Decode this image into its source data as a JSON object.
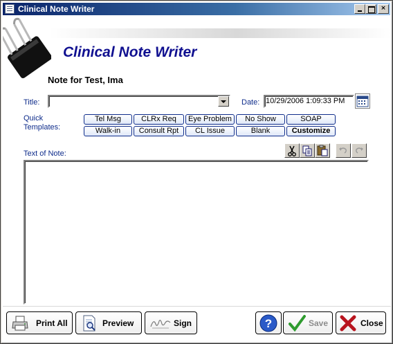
{
  "window": {
    "title": "Clinical Note Writer",
    "controls": {
      "minimize": "minimize",
      "maximize": "maximize",
      "close": "×"
    }
  },
  "header": {
    "heading": "Clinical Note Writer",
    "note_for": "Note for Test, Ima"
  },
  "form": {
    "title_label": "Title:",
    "title_value": "",
    "date_label": "Date:",
    "date_value": "10/29/2006 1:09:33 PM",
    "quick_templates_label_line1": "Quick",
    "quick_templates_label_line2": "Templates:",
    "text_of_note_label": "Text of Note:",
    "note_text": ""
  },
  "quick_templates": {
    "row1": [
      "Tel Msg",
      "CLRx Req",
      "Eye Problem",
      "No Show",
      "SOAP"
    ],
    "row2": [
      "Walk-in",
      "Consult Rpt",
      "CL Issue",
      "Blank",
      "Customize"
    ]
  },
  "editor_toolbar": {
    "icons": [
      "cut-icon",
      "copy-icon",
      "paste-icon",
      "undo-icon",
      "redo-icon"
    ]
  },
  "footer": {
    "print_all": "Print All",
    "preview": "Preview",
    "sign": "Sign",
    "save": "Save",
    "close": "Close"
  },
  "colors": {
    "label_blue": "#0d2b8a",
    "heading_blue": "#101090",
    "titlebar_start": "#0a246a",
    "save_check_green": "#2e9b2e",
    "close_x_red": "#b8141e"
  }
}
